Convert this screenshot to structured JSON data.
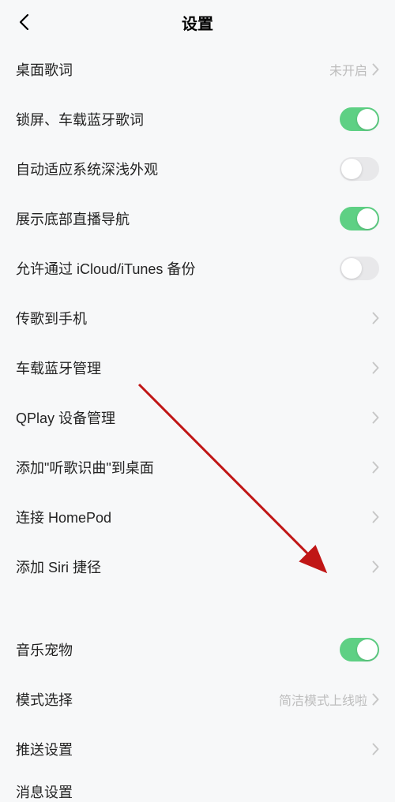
{
  "header": {
    "title": "设置"
  },
  "rows": [
    {
      "label": "桌面歌词",
      "type": "disclosure",
      "sub": "未开启"
    },
    {
      "label": "锁屏、车载蓝牙歌词",
      "type": "toggle",
      "on": true
    },
    {
      "label": "自动适应系统深浅外观",
      "type": "toggle",
      "on": false
    },
    {
      "label": "展示底部直播导航",
      "type": "toggle",
      "on": true
    },
    {
      "label": "允许通过 iCloud/iTunes 备份",
      "type": "toggle",
      "on": false
    },
    {
      "label": "传歌到手机",
      "type": "disclosure"
    },
    {
      "label": "车载蓝牙管理",
      "type": "disclosure"
    },
    {
      "label": "QPlay 设备管理",
      "type": "disclosure"
    },
    {
      "label": "添加\"听歌识曲\"到桌面",
      "type": "disclosure"
    },
    {
      "label": "连接 HomePod",
      "type": "disclosure"
    },
    {
      "label": "添加 Siri 捷径",
      "type": "disclosure"
    }
  ],
  "rows2": [
    {
      "label": "音乐宠物",
      "type": "toggle",
      "on": true
    },
    {
      "label": "模式选择",
      "type": "disclosure",
      "sub": "简洁模式上线啦"
    },
    {
      "label": "推送设置",
      "type": "disclosure"
    }
  ],
  "cutoff": "消息设置",
  "annotation": {
    "arrow_color": "#c01616"
  }
}
